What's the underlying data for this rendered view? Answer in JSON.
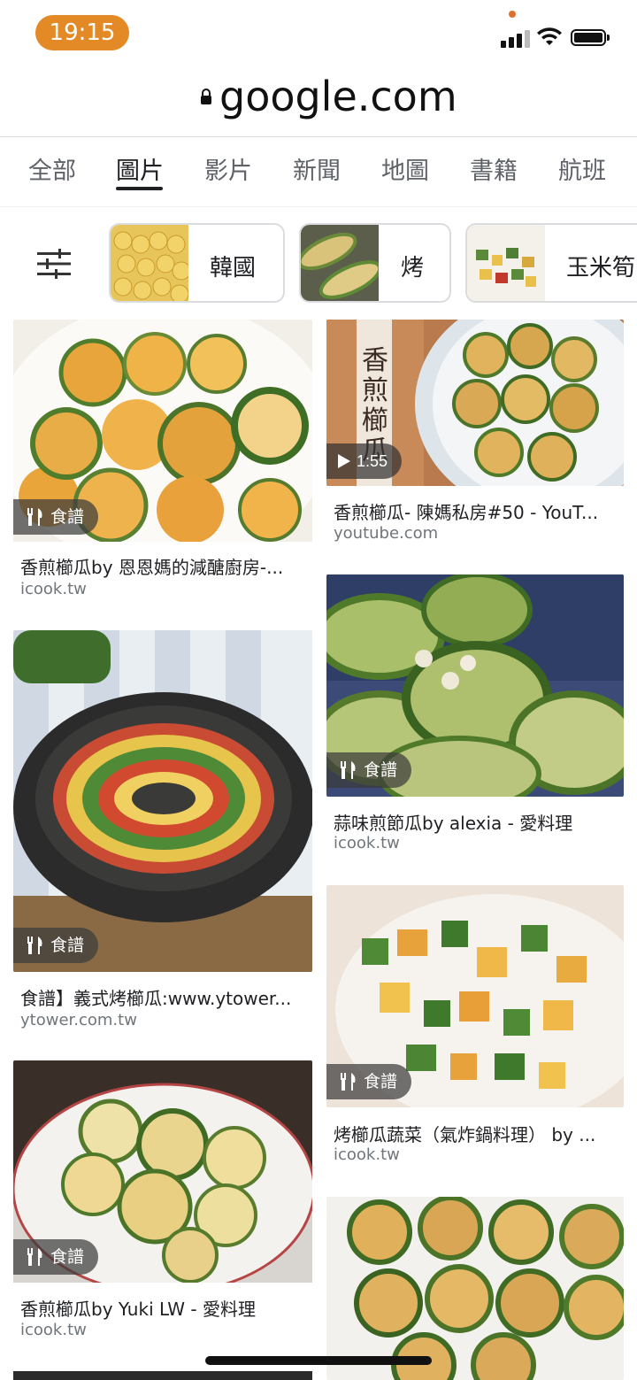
{
  "status": {
    "time": "19:15"
  },
  "browser": {
    "url": "google.com"
  },
  "tabs": [
    {
      "label": "全部"
    },
    {
      "label": "圖片"
    },
    {
      "label": "影片"
    },
    {
      "label": "新聞"
    },
    {
      "label": "地圖"
    },
    {
      "label": "書籍"
    },
    {
      "label": "航班"
    }
  ],
  "chips": [
    {
      "label": "韓國"
    },
    {
      "label": "烤"
    },
    {
      "label": "玉米筍"
    }
  ],
  "results": [
    {
      "title": "香煎櫛瓜by 恩恩媽的減醣廚房-...",
      "source": "icook.tw",
      "badge": "食譜"
    },
    {
      "title": "香煎櫛瓜- 陳媽私房#50 - YouT...",
      "source": "youtube.com",
      "badge": "1:55"
    },
    {
      "title": "蒜味煎節瓜by alexia - 愛料理",
      "source": "icook.tw",
      "badge": "食譜"
    },
    {
      "title": "食譜】義式烤櫛瓜:www.ytower...",
      "source": "ytower.com.tw",
      "badge": "食譜"
    },
    {
      "title": "烤櫛瓜蔬菜（氣炸鍋料理） by ...",
      "source": "icook.tw",
      "badge": "食譜"
    },
    {
      "title": "香煎櫛瓜by Yuki LW - 愛料理",
      "source": "icook.tw",
      "badge": "食譜"
    }
  ],
  "overlay_text": {
    "video_title": "香煎櫛瓜"
  },
  "colors": {
    "time_pill": "#e38a26",
    "text": "#202124",
    "muted": "#70757a"
  }
}
